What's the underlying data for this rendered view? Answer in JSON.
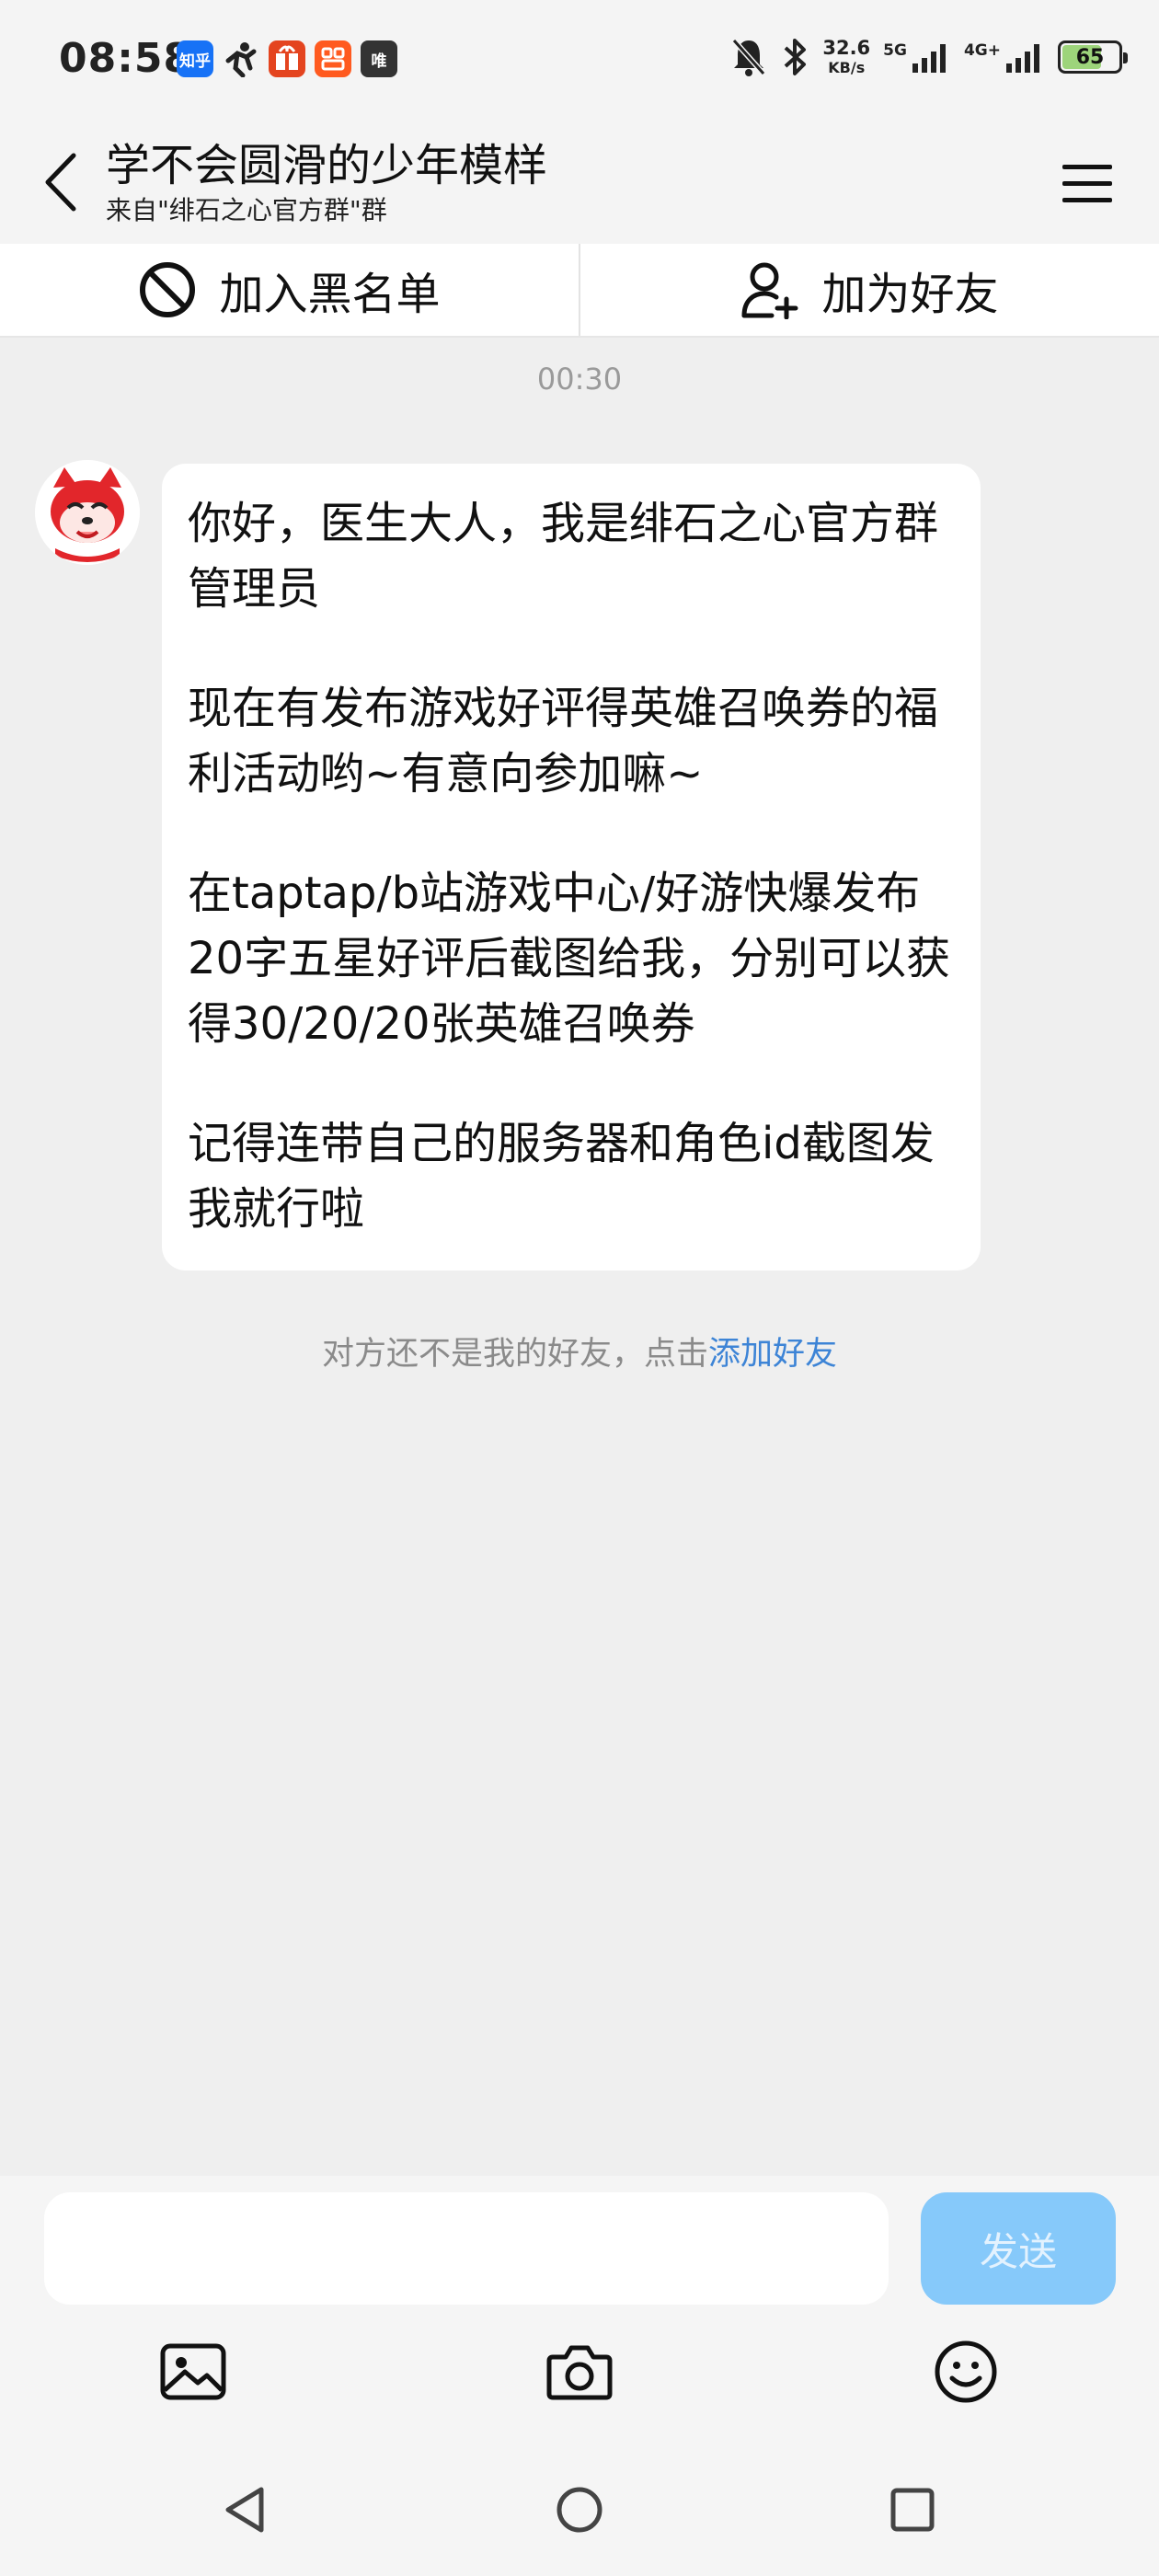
{
  "status_bar": {
    "time": "08:58",
    "app_icons": [
      {
        "name": "zhihu-icon",
        "label": "知乎"
      },
      {
        "name": "runner-app-icon",
        "label": ""
      },
      {
        "name": "gift-app-icon",
        "label": ""
      },
      {
        "name": "orange-app-icon",
        "label": ""
      },
      {
        "name": "mono-app-icon",
        "label": "唯"
      }
    ],
    "net_speed_value": "32.6",
    "net_speed_unit": "KB/s",
    "network_1": "5G",
    "network_2": "4G+",
    "battery": "65"
  },
  "header": {
    "title": "学不会圆滑的少年模样",
    "subtitle": "来自\"绯石之心官方群\"群"
  },
  "actions": {
    "blacklist_label": "加入黑名单",
    "add_friend_label": "加为好友"
  },
  "chat": {
    "timestamp": "00:30",
    "message_paragraphs": [
      "你好，医生大人，我是绯石之心官方群管理员",
      "现在有发布游戏好评得英雄召唤券的福利活动哟~有意向参加嘛~",
      "在taptap/b站游戏中心/好游快爆发布20字五星好评后截图给我，分别可以获得30/20/20张英雄召唤券",
      "记得连带自己的服务器和角色id截图发我就行啦"
    ],
    "system_note_prefix": "对方还不是我的好友，点击",
    "system_note_link": "添加好友"
  },
  "input": {
    "placeholder": "",
    "send_label": "发送"
  },
  "colors": {
    "link": "#3d84d6",
    "send_button": "#86c9fa",
    "background": "#efefef"
  }
}
